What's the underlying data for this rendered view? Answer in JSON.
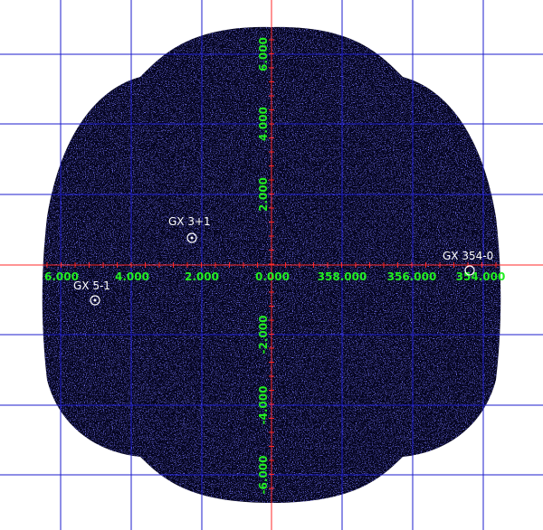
{
  "image": {
    "background": "#ffffff",
    "field_color": "#05051f",
    "noise_color": "#2a2ad8",
    "grid_color": "#1e1ecc",
    "axis_color": "#ff2a2a",
    "tick_label_color": "#22ee22",
    "marker_color": "#ffffff"
  },
  "axes": {
    "x_ticks": [
      "6.000",
      "4.000",
      "2.000",
      "0.000",
      "358.000",
      "356.000",
      "354.000"
    ],
    "y_ticks": [
      "6.000",
      "4.000",
      "2.000",
      "-2.000",
      "-4.000",
      "-6.000"
    ]
  },
  "sources": [
    {
      "name": "GX 3+1",
      "l": 2.3,
      "b": 0.8
    },
    {
      "name": "GX 5-1",
      "l": 5.1,
      "b": -1.0
    },
    {
      "name": "GX 354-0",
      "l": 354.3,
      "b": -0.1
    }
  ]
}
